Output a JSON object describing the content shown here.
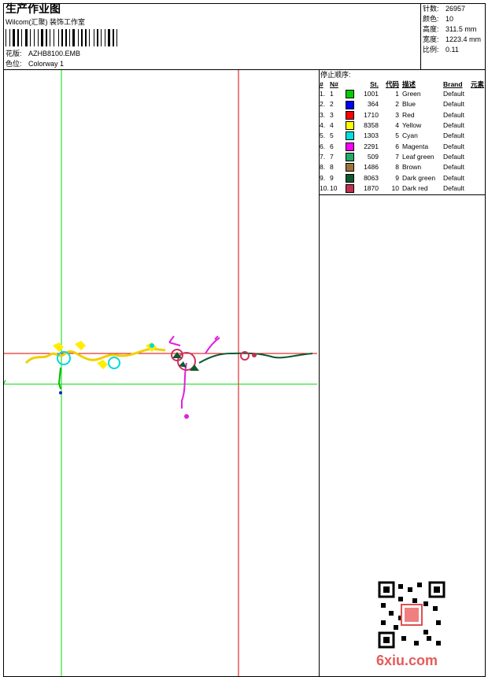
{
  "header": {
    "title": "生产作业图",
    "company": "Wilcom(汇聚) 装饰工作室",
    "design_label": "花版:",
    "design_value": "AZHB8100.EMB",
    "colorway_label": "色位:",
    "colorway_value": "Colorway 1"
  },
  "stats": {
    "stitches_label": "针数:",
    "stitches_value": "26957",
    "colors_label": "颜色:",
    "colors_value": "10",
    "height_label": "高度:",
    "height_value": "311.5 mm",
    "width_label": "宽度:",
    "width_value": "1223.4 mm",
    "scale_label": "比例:",
    "scale_value": "0.11"
  },
  "stop_sequence": {
    "title": "停止顺序:",
    "headers": [
      "#",
      "N#",
      "St.",
      "代码",
      "描述",
      "Brand",
      "元素"
    ],
    "rows": [
      {
        "idx": "1.",
        "n": "1",
        "st": "1001",
        "code": "1",
        "desc": "Green",
        "brand": "Default",
        "color": "#00cc00"
      },
      {
        "idx": "2.",
        "n": "2",
        "st": "364",
        "code": "2",
        "desc": "Blue",
        "brand": "Default",
        "color": "#0000ff"
      },
      {
        "idx": "3.",
        "n": "3",
        "st": "1710",
        "code": "3",
        "desc": "Red",
        "brand": "Default",
        "color": "#ff0000"
      },
      {
        "idx": "4.",
        "n": "4",
        "st": "8358",
        "code": "4",
        "desc": "Yellow",
        "brand": "Default",
        "color": "#ffff00"
      },
      {
        "idx": "5.",
        "n": "5",
        "st": "1303",
        "code": "5",
        "desc": "Cyan",
        "brand": "Default",
        "color": "#00e0e0"
      },
      {
        "idx": "6.",
        "n": "6",
        "st": "2291",
        "code": "6",
        "desc": "Magenta",
        "brand": "Default",
        "color": "#ff00ff"
      },
      {
        "idx": "7.",
        "n": "7",
        "st": "509",
        "code": "7",
        "desc": "Leaf green",
        "brand": "Default",
        "color": "#22aa66"
      },
      {
        "idx": "8.",
        "n": "8",
        "st": "1486",
        "code": "8",
        "desc": "Brown",
        "brand": "Default",
        "color": "#a0703a"
      },
      {
        "idx": "9.",
        "n": "9",
        "st": "8063",
        "code": "9",
        "desc": "Dark green",
        "brand": "Default",
        "color": "#0e5a2e"
      },
      {
        "idx": "10.",
        "n": "10",
        "st": "1870",
        "code": "10",
        "desc": "Dark red",
        "brand": "Default",
        "color": "#c03050"
      }
    ]
  },
  "watermark": "6xiu.com"
}
